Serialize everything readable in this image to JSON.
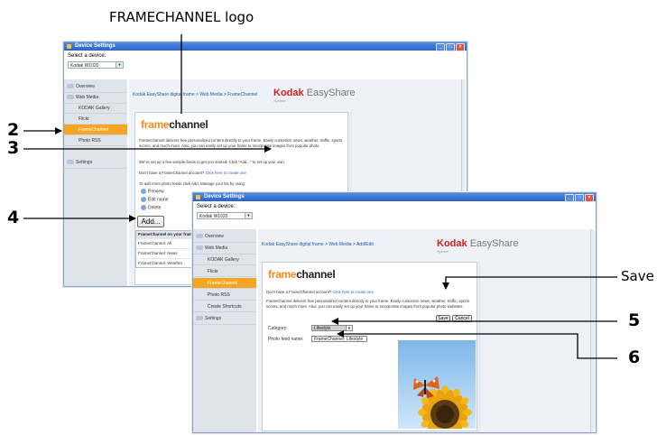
{
  "callouts": {
    "logo_label": "FRAMECHANNEL logo",
    "save_label": "Save",
    "n2": "2",
    "n3": "3",
    "n4": "4",
    "n5": "5",
    "n6": "6"
  },
  "window_back": {
    "title": "Device Settings",
    "select_label": "Select a device:",
    "device": "Kodak W1020",
    "sidebar": [
      "Overview",
      "Web Media",
      "KODAK Gallery",
      "Flickr",
      "FrameChannel",
      "Photo RSS",
      "Settings"
    ],
    "breadcrumb": "Kodak EasyShare digital frame > Web Media > FrameChannel",
    "brand": {
      "name": "Kodak",
      "product": "EasyShare",
      "sub": "System"
    },
    "logo": {
      "part1": "frame",
      "part2": "channel"
    },
    "desc": "FrameChannel delivers free personalized content directly to your frame. Easily customize news, weather, traffic, sports scores, and much more. Also, you can easily set up your frame to incorporate images from popular photo",
    "sample_text": "We've set up a few sample feeds to get you started. Click \"Add...\" to set up your own.",
    "account_text": "Don't have a FrameChannel account?",
    "account_link": "Click here to create one",
    "add_hint": "To add more photo feeds click Add. Manage your list by using:",
    "options": [
      "Preview",
      "Edit name",
      "Delete"
    ],
    "add_button": "Add...",
    "list_header": "FrameChannel on your frame",
    "list_rows": [
      "FrameChannel: All",
      "FrameChannel: News",
      "FrameChannel: Weather"
    ]
  },
  "window_front": {
    "title": "Device Settings",
    "select_label": "Select a device:",
    "device": "Kodak W1020",
    "sidebar": [
      "Overview",
      "Web Media",
      "KODAK Gallery",
      "Flickr",
      "FrameChannel",
      "Photo RSS",
      "Create Shortcuts",
      "Settings"
    ],
    "breadcrumb": "Kodak EasyShare digital frame > Web Media > Add/Edit",
    "brand": {
      "name": "Kodak",
      "product": "EasyShare",
      "sub": "System"
    },
    "logo": {
      "part1": "frame",
      "part2": "channel"
    },
    "account_text": "Don't have a FrameChannel account?",
    "account_link": "Click here to create one",
    "desc": "FrameChannel delivers free personalized content directly to your frame. Easily customize news, weather, traffic, sports scores, and much more. Also, you can easily set up your frame to incorporate images from popular photo websites.",
    "save_button": "Save",
    "cancel_button": "Cancel",
    "category_label": "Category:",
    "category_value": "Lifestyle",
    "feed_label": "Photo feed name:",
    "feed_value": "FrameChannel: Lifestyle"
  }
}
